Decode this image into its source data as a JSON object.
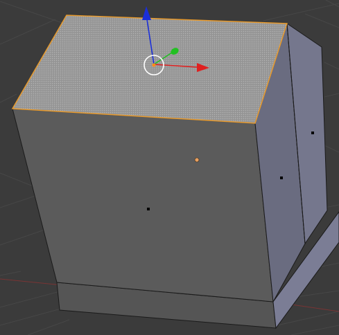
{
  "viewport": {
    "background_color": "#3b3b3b",
    "grid_line_color": "#474747",
    "x_axis_line_color": "#8a3a3a",
    "mode": "edit-mode",
    "selection": "top-face",
    "manipulator": "translate"
  },
  "colors": {
    "front_face": "#5a5a5a",
    "side_face": "#6b6d80",
    "side_face_far": "#7a7c92",
    "top_face": "#9b9b9b",
    "base_front": "#555555",
    "base_side": "#7c7e96",
    "edge_dark": "#1a1a1a",
    "edge_selected": "#e89a2c",
    "face_dot": "#000000",
    "face_dot_active": "#e8a060",
    "axis_x": "#e02020",
    "axis_y": "#22c022",
    "axis_z": "#1a2ed8",
    "pivot_ring": "#ffffff",
    "pivot_center": "#ff8c1a"
  },
  "icons": {
    "x_axis_arrow": "arrow-right-icon",
    "y_axis_handle": "y-handle-icon",
    "z_axis_arrow": "arrow-up-icon",
    "pivot": "circle-icon"
  }
}
